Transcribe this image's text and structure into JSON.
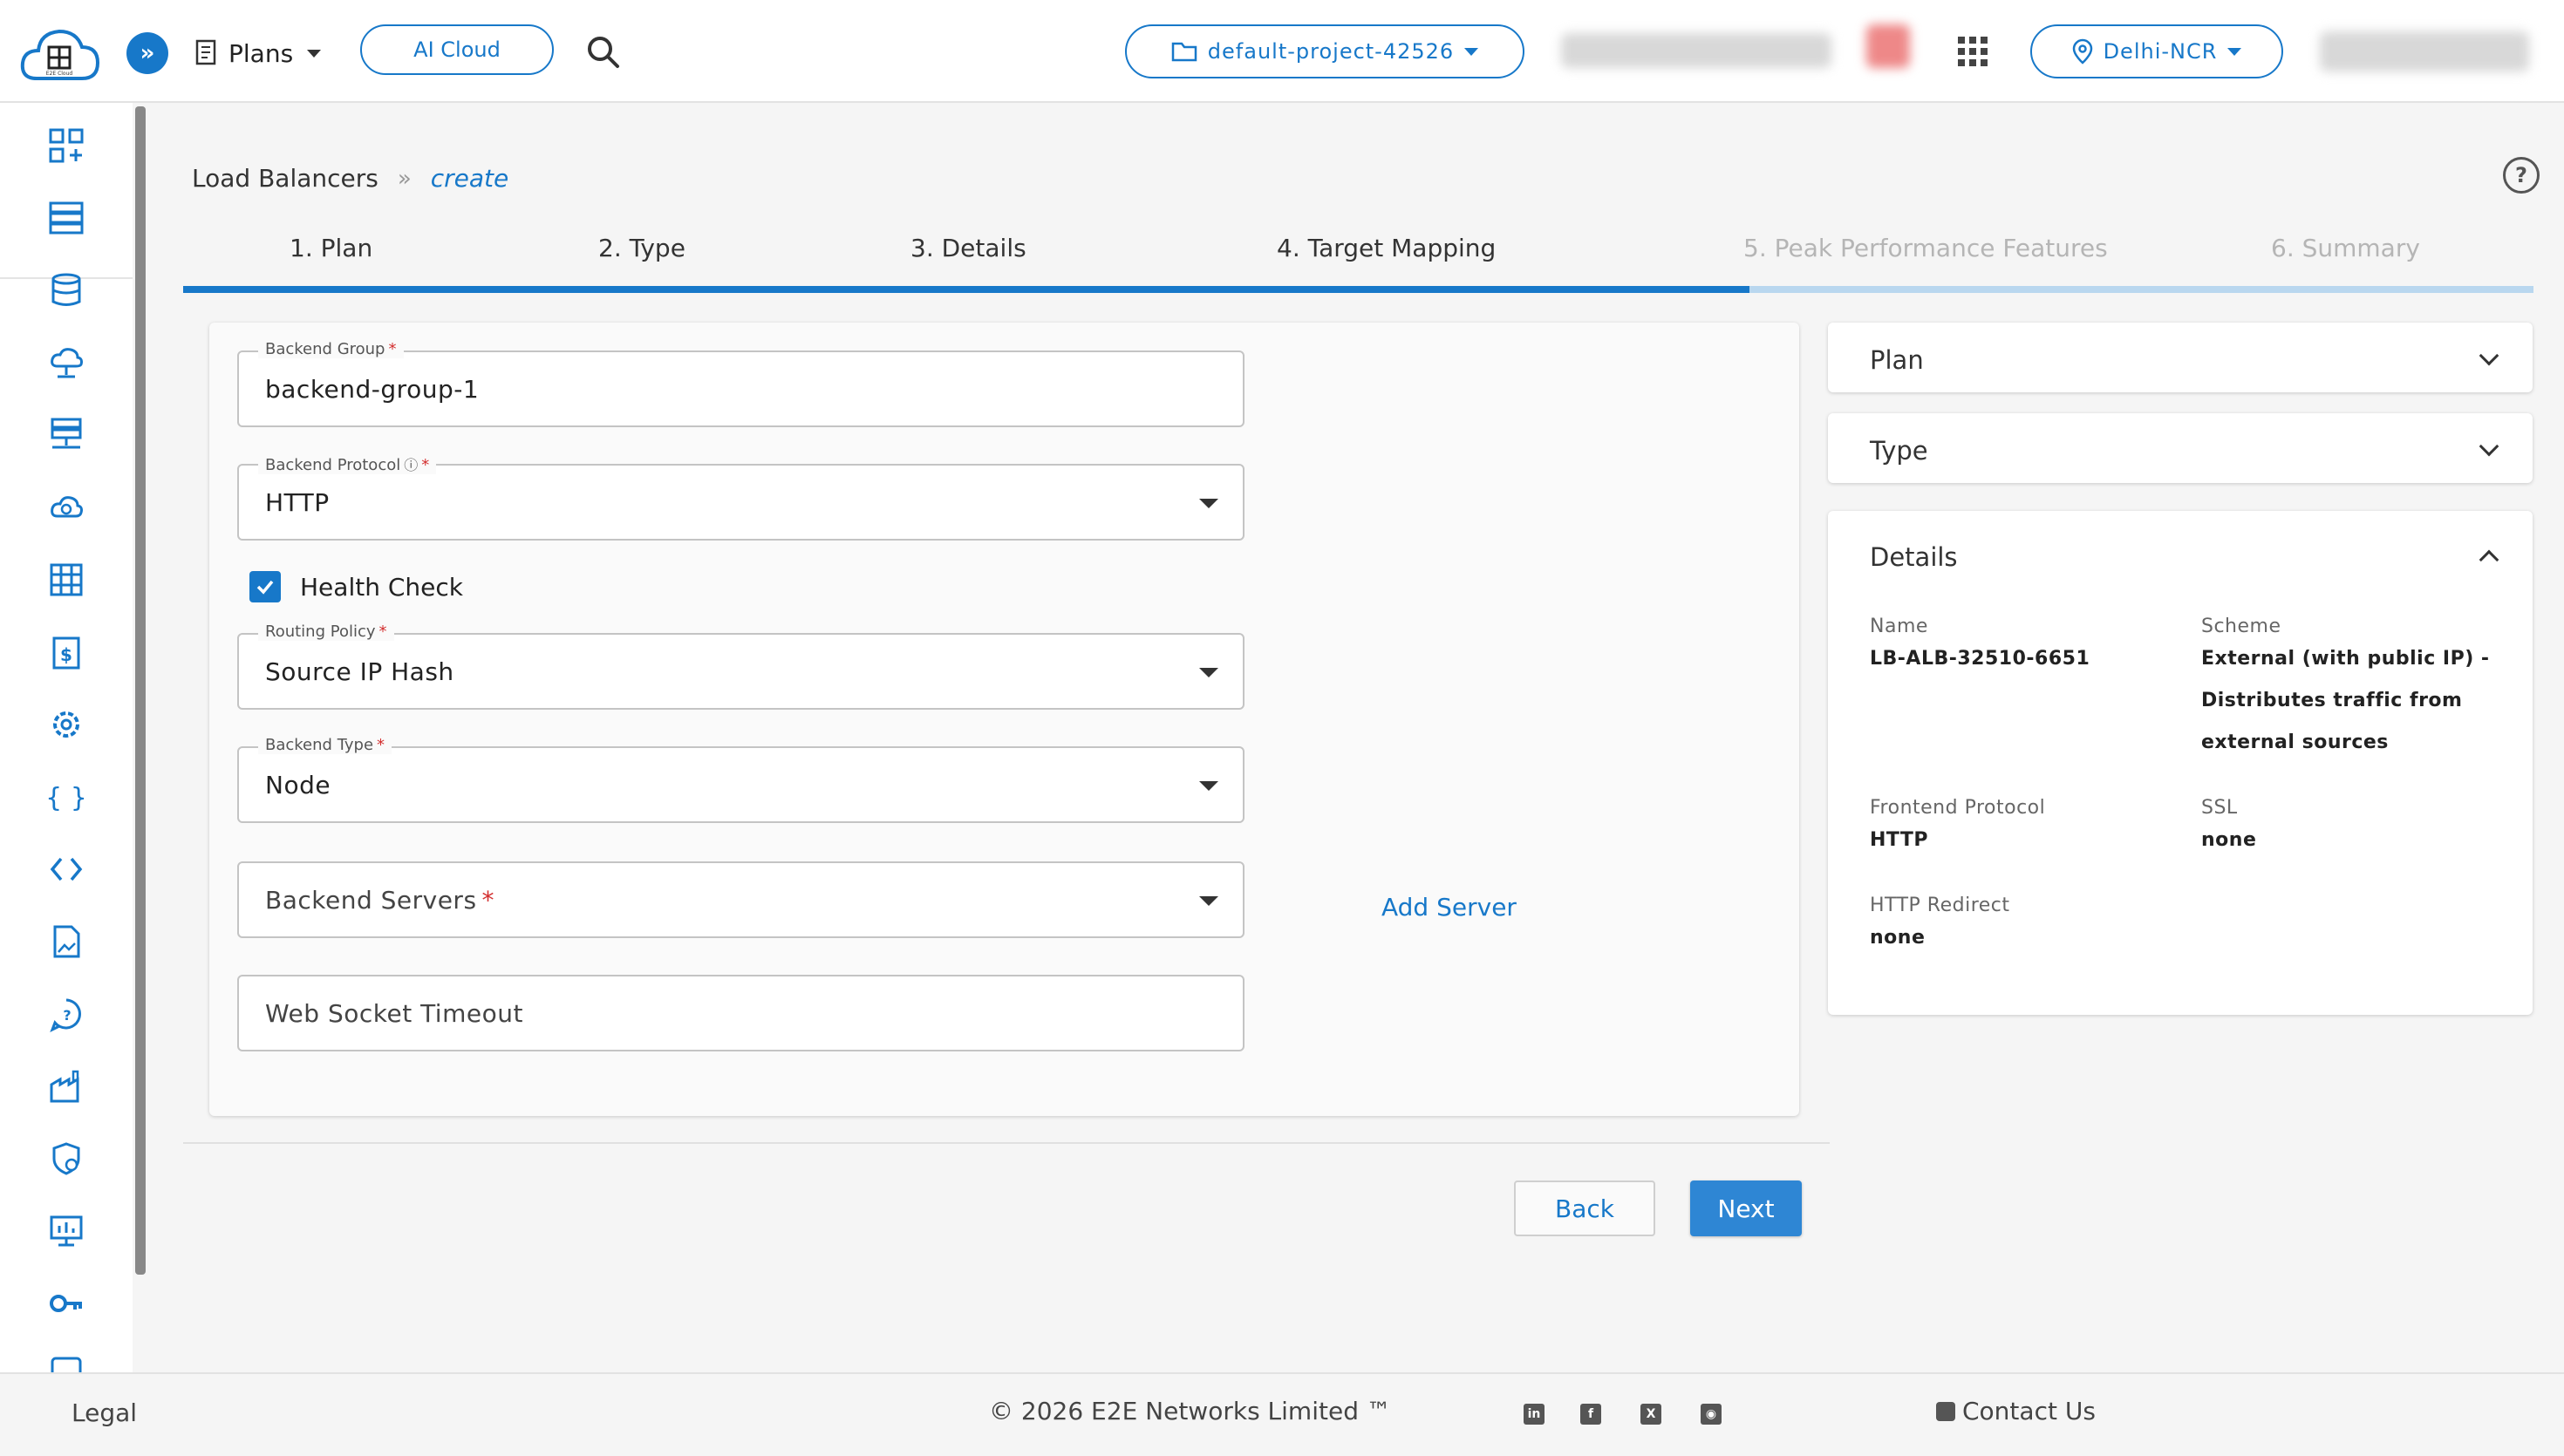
{
  "header": {
    "plans_label": "Plans",
    "ai_cloud_label": "AI Cloud",
    "project_label": "default-project-42526",
    "region_label": "Delhi-NCR",
    "logo_text": "E2E Cloud"
  },
  "breadcrumb": {
    "parent": "Load Balancers",
    "separator": "»",
    "current": "create"
  },
  "steps": [
    {
      "label": "1. Plan",
      "state": "done"
    },
    {
      "label": "2. Type",
      "state": "done"
    },
    {
      "label": "3. Details",
      "state": "done"
    },
    {
      "label": "4. Target Mapping",
      "state": "active"
    },
    {
      "label": "5. Peak Performance Features",
      "state": "disabled"
    },
    {
      "label": "6. Summary",
      "state": "disabled"
    }
  ],
  "form": {
    "backend_group": {
      "label": "Backend Group",
      "value": "backend-group-1"
    },
    "backend_protocol": {
      "label": "Backend Protocol",
      "value": "HTTP"
    },
    "health_check": {
      "label": "Health Check",
      "checked": true
    },
    "routing_policy": {
      "label": "Routing Policy",
      "value": "Source IP Hash"
    },
    "backend_type": {
      "label": "Backend Type",
      "value": "Node"
    },
    "backend_servers": {
      "placeholder": "Backend Servers"
    },
    "web_socket_timeout": {
      "placeholder": "Web Socket Timeout"
    },
    "add_server_label": "Add Server",
    "required_mark": "*"
  },
  "actions": {
    "back_label": "Back",
    "next_label": "Next"
  },
  "summary": {
    "plan_title": "Plan",
    "type_title": "Type",
    "details_title": "Details",
    "details": {
      "name_label": "Name",
      "name_value": "LB-ALB-32510-6651",
      "scheme_label": "Scheme",
      "scheme_value": "External (with public IP) - Distributes traffic from external sources",
      "frontend_protocol_label": "Frontend Protocol",
      "frontend_protocol_value": "HTTP",
      "ssl_label": "SSL",
      "ssl_value": "none",
      "http_redirect_label": "HTTP Redirect",
      "http_redirect_value": "none"
    }
  },
  "footer": {
    "legal": "Legal",
    "copyright": "© 2026 E2E Networks Limited ™",
    "contact": "Contact Us"
  },
  "colors": {
    "primary": "#1778c9",
    "required": "#d32f2f",
    "disabled_step": "#b5b5b5"
  }
}
